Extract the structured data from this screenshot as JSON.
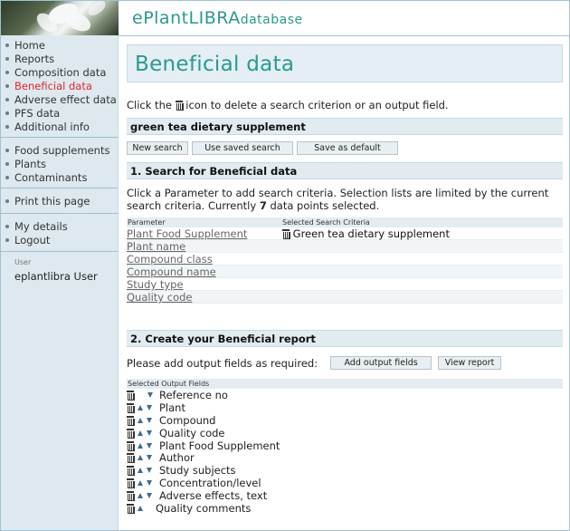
{
  "brand": {
    "main": "ePlantLIBRA",
    "suffix": "database"
  },
  "sidebar": {
    "groups": [
      {
        "items": [
          {
            "label": "Home",
            "active": false
          },
          {
            "label": "Reports",
            "active": false
          },
          {
            "label": "Composition data",
            "active": false
          },
          {
            "label": "Beneficial data",
            "active": true
          },
          {
            "label": "Adverse effect data",
            "active": false
          },
          {
            "label": "PFS data",
            "active": false
          },
          {
            "label": "Additional info",
            "active": false
          }
        ]
      },
      {
        "items": [
          {
            "label": "Food supplements"
          },
          {
            "label": "Plants"
          },
          {
            "label": "Contaminants"
          }
        ]
      },
      {
        "items": [
          {
            "label": "Print this page"
          }
        ]
      },
      {
        "items": [
          {
            "label": "My details"
          },
          {
            "label": "Logout"
          }
        ]
      }
    ],
    "user_label": "User",
    "user_name": "eplantlibra User"
  },
  "main": {
    "title": "Beneficial data",
    "intro_before": "Click the",
    "intro_after": "icon to delete a search criterion or an output field.",
    "search_name": "green tea dietary supplement",
    "buttons": {
      "new_search": "New search",
      "use_saved": "Use saved search",
      "save_default": "Save as default"
    },
    "section1_title": "1. Search for Beneficial data",
    "section1_desc_a": "Click a Parameter to add search criteria. Selection lists are limited by the current search criteria. Currently",
    "section1_count": "7",
    "section1_desc_b": "data points selected.",
    "criteria_header": {
      "parameter": "Parameter",
      "selected": "Selected Search Criteria"
    },
    "criteria": [
      {
        "parameter": "Plant Food Supplement",
        "value": "Green tea dietary supplement"
      },
      {
        "parameter": "Plant name",
        "value": ""
      },
      {
        "parameter": "Compound class",
        "value": ""
      },
      {
        "parameter": "Compound name",
        "value": ""
      },
      {
        "parameter": "Study type",
        "value": ""
      },
      {
        "parameter": "Quality code",
        "value": ""
      }
    ],
    "section2_title": "2. Create your Beneficial report",
    "output_prompt": "Please add output fields as required:",
    "add_fields_btn": "Add output fields",
    "view_report_btn": "View report",
    "output_header": "Selected Output Fields",
    "output_fields": [
      {
        "label": "Reference no",
        "up": false,
        "down": true
      },
      {
        "label": "Plant",
        "up": true,
        "down": true
      },
      {
        "label": "Compound",
        "up": true,
        "down": true
      },
      {
        "label": "Quality code",
        "up": true,
        "down": true
      },
      {
        "label": "Plant Food Supplement",
        "up": true,
        "down": true
      },
      {
        "label": "Author",
        "up": true,
        "down": true
      },
      {
        "label": "Study subjects",
        "up": true,
        "down": true
      },
      {
        "label": "Concentration/level",
        "up": true,
        "down": true
      },
      {
        "label": "Adverse effects, text",
        "up": true,
        "down": true
      },
      {
        "label": "Quality comments",
        "up": true,
        "down": false
      }
    ]
  }
}
